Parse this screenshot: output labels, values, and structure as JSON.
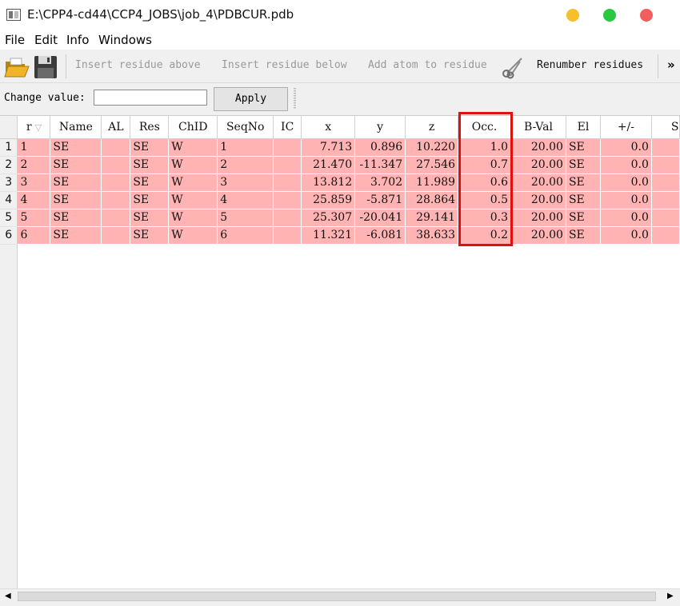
{
  "window": {
    "title": "E:\\CPP4-cd44\\CCP4_JOBS\\job_4\\PDBCUR.pdb"
  },
  "menu": [
    "File",
    "Edit",
    "Info",
    "Windows"
  ],
  "toolbar": {
    "open_icon": "folder-open-icon",
    "save_icon": "save-disk-icon",
    "insert_above": "Insert residue above",
    "insert_below": "Insert residue below",
    "add_atom": "Add atom to residue",
    "scissors_icon": "scissors-icon",
    "renumber": "Renumber residues",
    "more": "»"
  },
  "value_bar": {
    "label": "Change value:",
    "value": "",
    "apply": "Apply"
  },
  "table": {
    "columns": [
      "r",
      "Name",
      "AL",
      "Res",
      "ChID",
      "SeqNo",
      "IC",
      "x",
      "y",
      "z",
      "Occ.",
      "B-Val",
      "El",
      "+/-",
      "S"
    ],
    "rows": [
      {
        "hdr": "1",
        "cells": [
          "1",
          "SE",
          "",
          "SE",
          "W",
          "1",
          "",
          "7.713",
          "0.896",
          "10.220",
          "1.0",
          "20.00",
          "SE",
          "0.0",
          ""
        ]
      },
      {
        "hdr": "2",
        "cells": [
          "2",
          "SE",
          "",
          "SE",
          "W",
          "2",
          "",
          "21.470",
          "-11.347",
          "27.546",
          "0.7",
          "20.00",
          "SE",
          "0.0",
          ""
        ]
      },
      {
        "hdr": "3",
        "cells": [
          "3",
          "SE",
          "",
          "SE",
          "W",
          "3",
          "",
          "13.812",
          "3.702",
          "11.989",
          "0.6",
          "20.00",
          "SE",
          "0.0",
          ""
        ]
      },
      {
        "hdr": "4",
        "cells": [
          "4",
          "SE",
          "",
          "SE",
          "W",
          "4",
          "",
          "25.859",
          "-5.871",
          "28.864",
          "0.5",
          "20.00",
          "SE",
          "0.0",
          ""
        ]
      },
      {
        "hdr": "5",
        "cells": [
          "5",
          "SE",
          "",
          "SE",
          "W",
          "5",
          "",
          "25.307",
          "-20.041",
          "29.141",
          "0.3",
          "20.00",
          "SE",
          "0.0",
          ""
        ]
      },
      {
        "hdr": "6",
        "cells": [
          "6",
          "SE",
          "",
          "SE",
          "W",
          "6",
          "",
          "11.321",
          "-6.081",
          "38.633",
          "0.2",
          "20.00",
          "SE",
          "0.0",
          ""
        ]
      }
    ]
  },
  "colors": {
    "row_highlight": "#ffb3b3",
    "occ_outline": "#e01010"
  }
}
